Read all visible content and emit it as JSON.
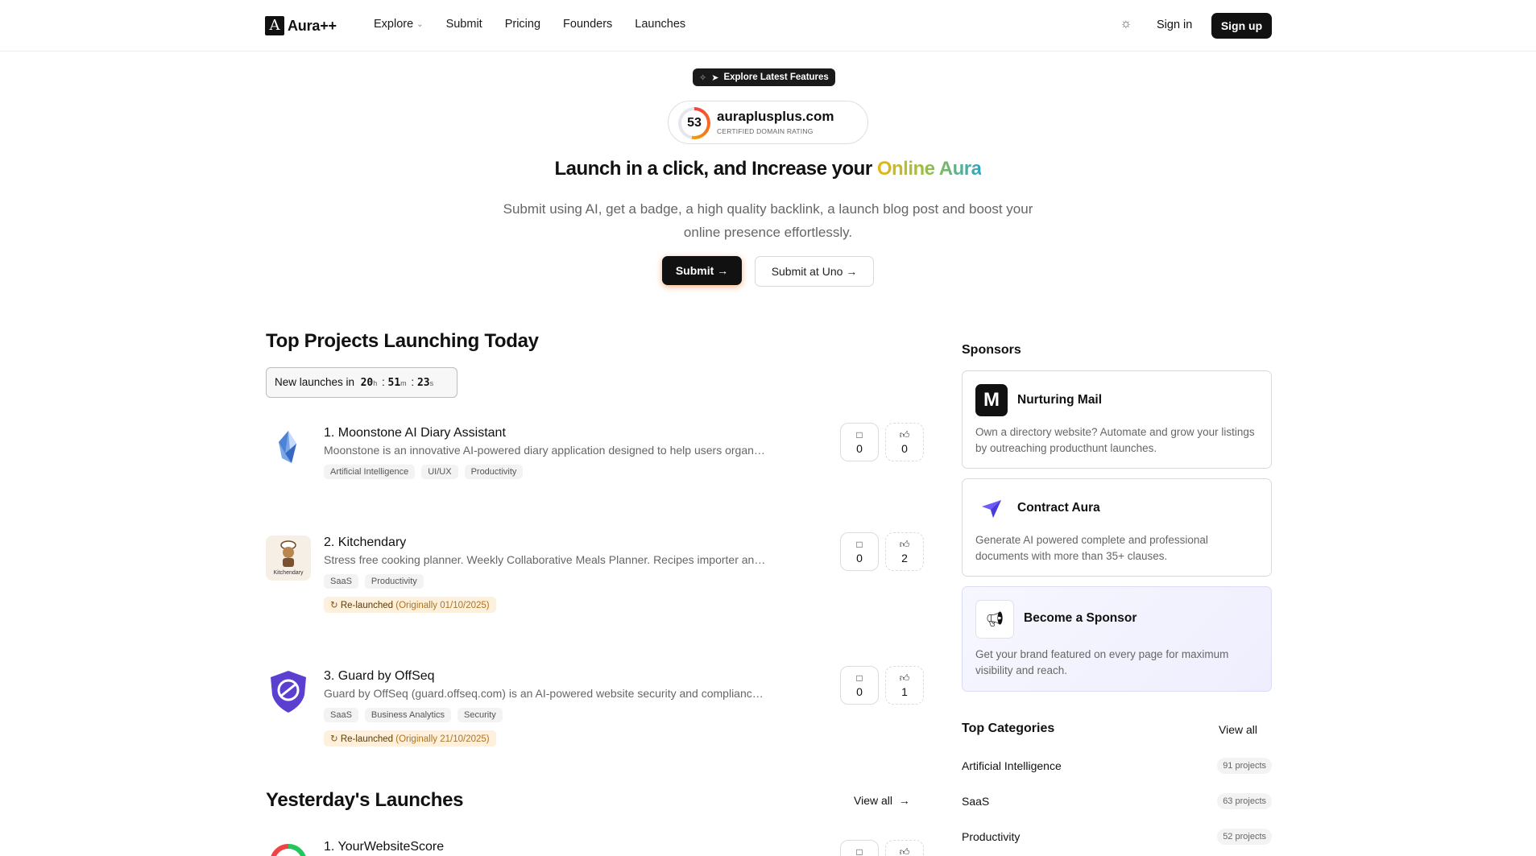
{
  "header": {
    "logo_mark": "A",
    "logo_text": "Aura++",
    "nav": [
      "Explore",
      "Submit",
      "Pricing",
      "Founders",
      "Launches"
    ],
    "sign_in": "Sign in",
    "sign_up": "Sign up"
  },
  "hero": {
    "pill": "Explore Latest Features",
    "domain": "auraplusplus.com",
    "domain_sub": "CERTIFIED DOMAIN RATING",
    "rating": "53",
    "rating_value": 53,
    "title_main": "Launch in a click, and Increase your ",
    "title_accent": "Online Aura",
    "subtitle": "Submit using AI, get a badge, a high quality backlink, a launch blog post and boost your online presence effortlessly.",
    "submit": "Submit",
    "submit_uno": "Submit at Uno"
  },
  "today": {
    "title": "Top Projects Launching Today",
    "countdown_label": "New launches in",
    "hours": "20",
    "hours_unit": "h",
    "minutes": "51",
    "minutes_unit": "m",
    "seconds": "23",
    "seconds_unit": "s",
    "projects": [
      {
        "title": "1. Moonstone AI Diary Assistant",
        "desc": "Moonstone is an innovative AI-powered diary application designed to help users organize their thoughts and emotions",
        "tags": [
          "Artificial Intelligence",
          "UI/UX",
          "Productivity"
        ],
        "comments": "0",
        "upvotes": "0"
      },
      {
        "title": "2. Kitchendary",
        "desc": "Stress free cooking planner. Weekly Collaborative Meals Planner. Recipes importer and...",
        "tags": [
          "SaaS",
          "Productivity"
        ],
        "relaunch_label": "Re-launched",
        "relaunch_orig": "(Originally 01/10/2025)",
        "thumb_caption": "Kitchendary",
        "comments": "0",
        "upvotes": "2"
      },
      {
        "title": "3. Guard by OffSeq",
        "desc": "Guard by OffSeq (guard.offseq.com) is an AI-powered website security and compliance analysis platform",
        "tags": [
          "SaaS",
          "Business Analytics",
          "Security"
        ],
        "relaunch_label": "Re-launched",
        "relaunch_orig": "(Originally 21/10/2025)",
        "comments": "0",
        "upvotes": "1"
      }
    ]
  },
  "yesterday": {
    "title": "Yesterday's Launches",
    "view_all": "View all",
    "first_title": "1. YourWebsiteScore"
  },
  "sidebar": {
    "sponsors_title": "Sponsors",
    "sponsors": [
      {
        "name": "Nurturing Mail",
        "logo_letter": "M",
        "desc": "Own a directory website? Automate and grow your listings by outreaching producthunt launches."
      },
      {
        "name": "Contract Aura",
        "desc": "Generate AI powered complete and professional documents with more than 35+ clauses."
      },
      {
        "name": "Become a Sponsor",
        "desc": "Get your brand featured on every page for maximum visibility and reach."
      }
    ],
    "categories_title": "Top Categories",
    "categories_view_all": "View all",
    "categories": [
      {
        "name": "Artificial Intelligence",
        "count": "91 projects"
      },
      {
        "name": "SaaS",
        "count": "63 projects"
      },
      {
        "name": "Productivity",
        "count": "52 projects"
      }
    ]
  },
  "colors": {
    "primary": "#111111",
    "accent_gradient": [
      "#e8b417",
      "#9cc13c",
      "#2fa6c4"
    ],
    "relaunch_bg": "#fdf0dd",
    "sponsor_highlight_bg": "#f3f2fe"
  }
}
